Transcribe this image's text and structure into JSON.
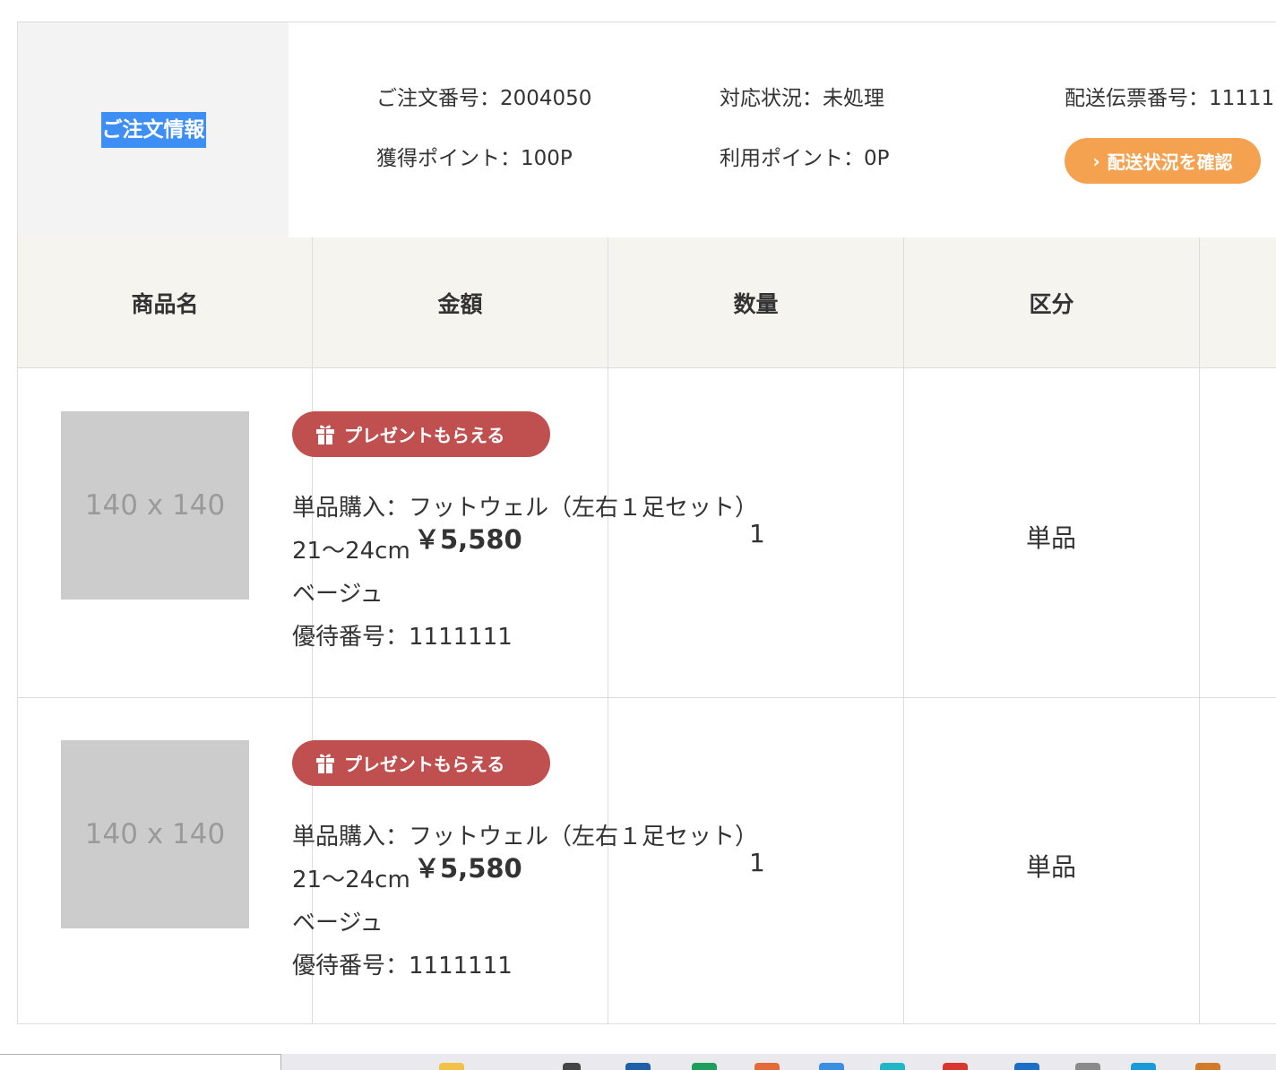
{
  "order_info": {
    "label": "ご注文情報",
    "order_number": "ご注文番号：2004050",
    "status": "対応状況：未処理",
    "tracking_number": "配送伝票番号：11111",
    "earned_points": "獲得ポイント：100P",
    "used_points": "利用ポイント：0P",
    "shipping_button": "配送状況を確認",
    "shipping_button_icon": "chevron-right-icon"
  },
  "table": {
    "headers": [
      "商品名",
      "金額",
      "数量",
      "区分"
    ],
    "rows": [
      {
        "thumbnail": "140 x 140",
        "badge": "プレゼントもらえる",
        "badge_icon": "gift-icon",
        "lines": [
          "単品購入：フットウェル（左右１足セット）",
          "21～24cm",
          "ベージュ",
          "優待番号：1111111"
        ],
        "price": "￥5,580",
        "quantity": "1",
        "category": "単品"
      },
      {
        "thumbnail": "140 x 140",
        "badge": "プレゼントもらえる",
        "badge_icon": "gift-icon",
        "lines": [
          "単品購入：フットウェル（左右１足セット）",
          "21～24cm",
          "ベージュ",
          "優待番号：1111111"
        ],
        "price": "￥5,580",
        "quantity": "1",
        "category": "単品"
      }
    ]
  },
  "colors": {
    "shipping_button": "#f4a24f",
    "present_badge": "#c0504f",
    "selection": "#3d8ff6",
    "header_bg": "#f5f4ef",
    "label_bg": "#f3f3f3"
  }
}
